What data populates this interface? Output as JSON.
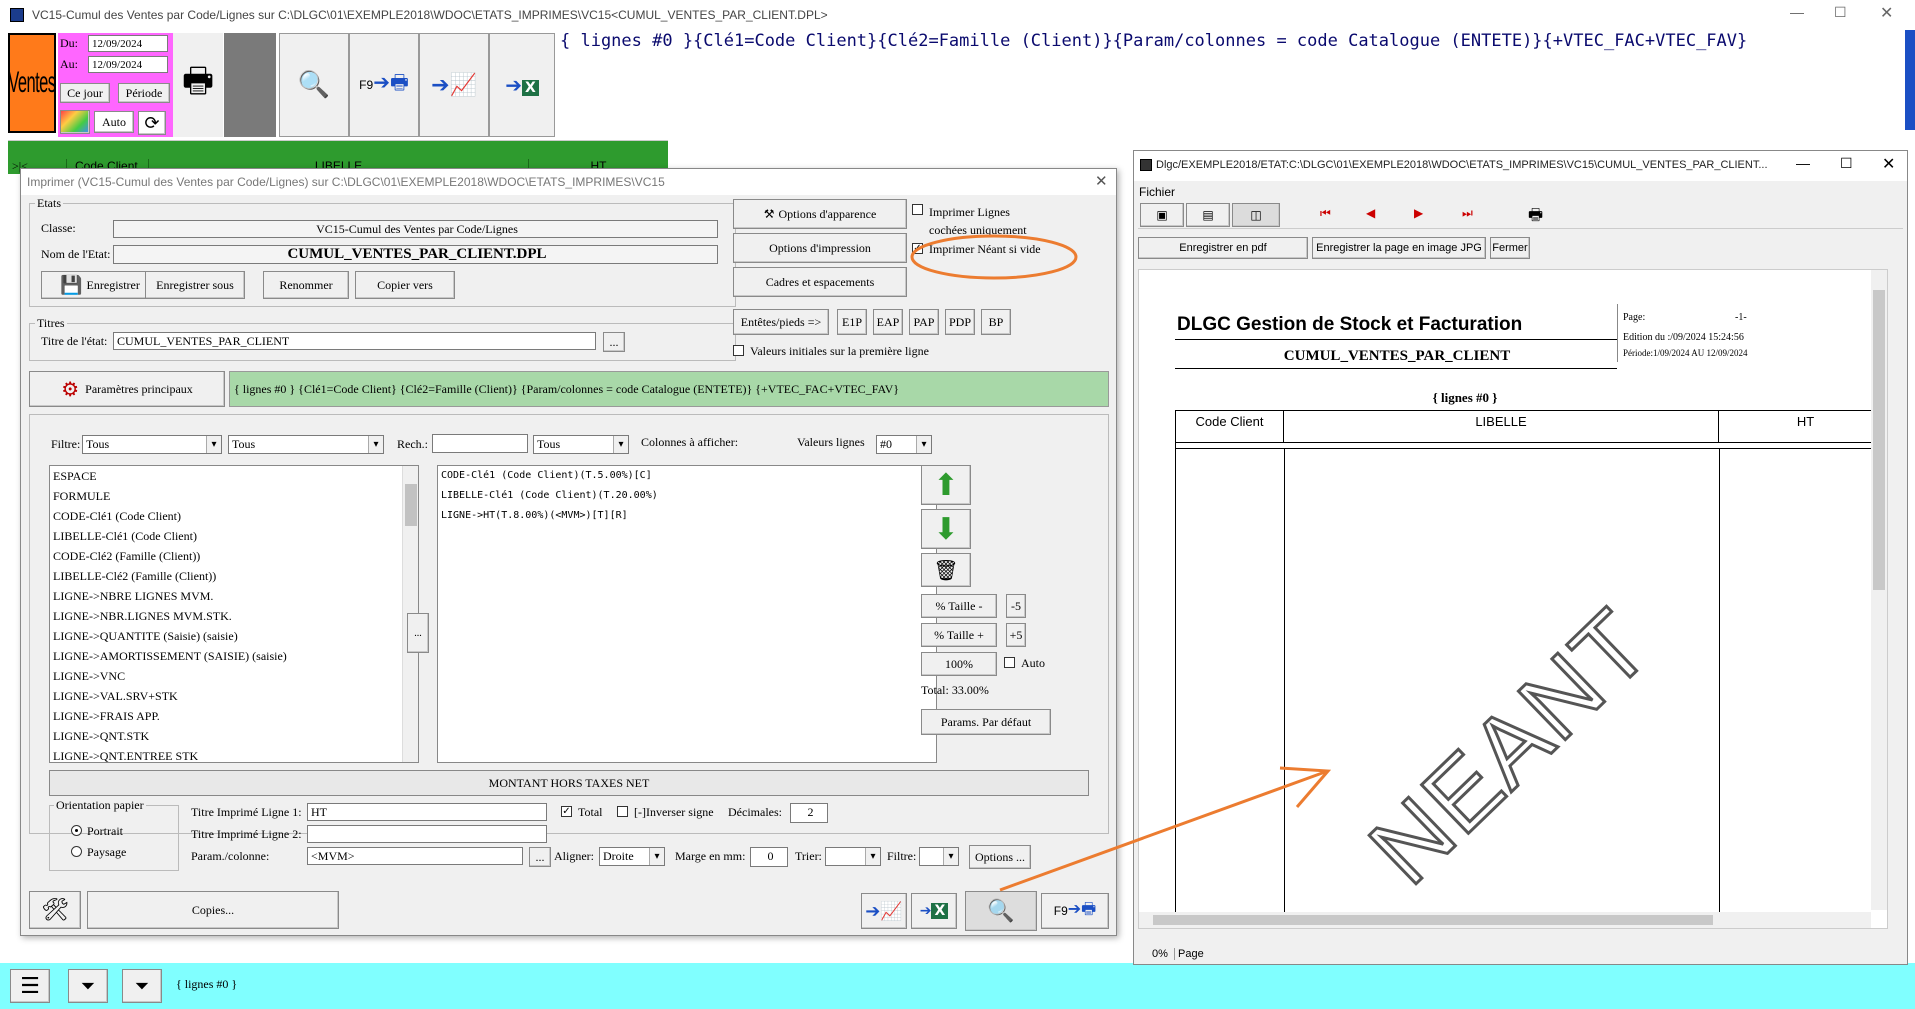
{
  "main_window": {
    "title": "VC15-Cumul des Ventes par Code/Lignes sur C:\\DLGC\\01\\EXEMPLE2018\\WDOC\\ETATS_IMPRIMES\\VC15<CUMUL_VENTES_PAR_CLIENT.DPL>",
    "logo_text": "Ventes",
    "du_label": "Du:",
    "du_value": "12/09/2024",
    "au_label": "Au:",
    "au_value": "12/09/2024",
    "ce_jour": "Ce jour",
    "periode": "Période",
    "auto": "Auto",
    "f9": "F9",
    "param_string": "{ lignes #0 }{Clé1=Code Client}{Clé2=Famille (Client)}{Param/colonnes = code Catalogue (ENTETE)}{+VTEC_FAC+VTEC_FAV}",
    "grid_headers": [
      ">|<",
      "Code Client",
      "LIBELLE",
      "HT"
    ],
    "status_text": "{ lignes #0 }"
  },
  "dialog": {
    "title": "Imprimer (VC15-Cumul des Ventes par Code/Lignes)  sur C:\\DLGC\\01\\EXEMPLE2018\\WDOC\\ETATS_IMPRIMES\\VC15",
    "etats_group": "Etats",
    "classe_label": "Classe:",
    "classe_value": "VC15-Cumul des Ventes par Code/Lignes",
    "nom_label": "Nom de l'Etat:",
    "nom_value": "CUMUL_VENTES_PAR_CLIENT.DPL",
    "enregistrer": "Enregistrer",
    "enregistrer_sous": "Enregistrer sous",
    "renommer": "Renommer",
    "copier_vers": "Copier vers",
    "titres_group": "Titres",
    "titre_label": "Titre de l'état:",
    "titre_value": "CUMUL_VENTES_PAR_CLIENT",
    "ellipsis": "...",
    "options_apparence": "Options d'apparence",
    "options_impression": "Options d'impression",
    "cadres": "Cadres et espacements",
    "imprimer_lignes": "Imprimer Lignes cochées uniquement",
    "imprimer_neant": "Imprimer Néant si vide",
    "entetes": "Entêtes/pieds =>",
    "e1p": "E1P",
    "eap": "EAP",
    "pap": "PAP",
    "pdp": "PDP",
    "bp": "BP",
    "valeurs_initiales": "Valeurs initiales sur la première ligne",
    "params_principaux": "Paramètres principaux",
    "params_string": "{ lignes #0 } {Clé1=Code Client} {Clé2=Famille (Client)} {Param/colonnes = code Catalogue (ENTETE)} {+VTEC_FAC+VTEC_FAV}",
    "filtre_label": "Filtre:",
    "filtre1": "Tous",
    "filtre2": "Tous",
    "rech_label": "Rech.:",
    "rech_value": "",
    "rech_combo": "Tous",
    "colonnes_label": "Colonnes à afficher:",
    "valeurs_lignes_label": "Valeurs lignes",
    "valeurs_lignes_value": "#0",
    "available_columns": [
      "ESPACE",
      "FORMULE",
      "CODE-Clé1 (Code Client)",
      "LIBELLE-Clé1 (Code Client)",
      "CODE-Clé2 (Famille (Client))",
      "LIBELLE-Clé2 (Famille (Client))",
      "LIGNE->NBRE LIGNES MVM.",
      "LIGNE->NBR.LIGNES MVM.STK.",
      "LIGNE->QUANTITE (Saisie) (saisie)",
      "LIGNE->AMORTISSEMENT (SAISIE) (saisie)",
      "LIGNE->VNC",
      "LIGNE->VAL.SRV+STK",
      "LIGNE->FRAIS APP.",
      "LIGNE->QNT.STK",
      "LIGNE->QNT.ENTREE STK"
    ],
    "selected_columns": [
      "CODE-Clé1 (Code Client)(T.5.00%)[C]",
      "LIBELLE-Clé1 (Code Client)(T.20.00%)",
      "LIGNE->HT(T.8.00%)(<MVM>)[T][R]"
    ],
    "arrow_btn": "...",
    "taille_moins": "% Taille -",
    "moins5": "-5",
    "taille_plus": "% Taille +",
    "plus5": "+5",
    "cent": "100%",
    "auto": "Auto",
    "total": "Total:  33.00%",
    "params_defaut": "Params. Par défaut",
    "montant": "MONTANT HORS TAXES  NET",
    "orientation_group": "Orientation papier",
    "portrait": "Portrait",
    "paysage": "Paysage",
    "titre1_label": "Titre Imprimé Ligne 1:",
    "titre1_value": "HT",
    "total_cb": "Total",
    "inverser": "[-]Inverser signe",
    "decimales_label": "Décimales:",
    "decimales_value": "2",
    "titre2_label": "Titre Imprimé Ligne 2:",
    "titre2_value": "",
    "param_col_label": "Param./colonne:",
    "param_col_value": "<MVM>",
    "aligner_label": "Aligner:",
    "aligner_value": "Droite",
    "marge_label": "Marge en mm:",
    "marge_value": "0",
    "trier_label": "Trier:",
    "filtre_col_label": "Filtre:",
    "options": "Options ...",
    "copies": "Copies...",
    "f9": "F9"
  },
  "preview": {
    "title": "Dlgc/EXEMPLE2018/ETAT:C:\\DLGC\\01\\EXEMPLE2018\\WDOC\\ETATS_IMPRIMES\\VC15\\CUMUL_VENTES_PAR_CLIENT...",
    "menu_fichier": "Fichier",
    "pdf": "Enregistrer en pdf",
    "jpg": "Enregistrer la page en image JPG",
    "fermer": "Fermer",
    "company": "DLGC Gestion de Stock et Facturation",
    "page_label": "Page:",
    "page_value": "-1-",
    "edition": "Edition du :/09/2024 15:24:56",
    "periode": "Période:1/09/2024 AU 12/09/2024",
    "report_title": "CUMUL_VENTES_PAR_CLIENT",
    "lignes": "{ lignes #0 }",
    "columns": [
      "Code Client",
      "LIBELLE",
      "HT"
    ],
    "watermark": "NEANT",
    "zoom": "0%",
    "status_page": "Page"
  },
  "colors": {
    "accent_orange": "#ec7c30",
    "green": "#2e9b2e",
    "magenta": "#ff66ff",
    "cyan": "#80ffff",
    "param_bg": "#a8d8a8"
  }
}
